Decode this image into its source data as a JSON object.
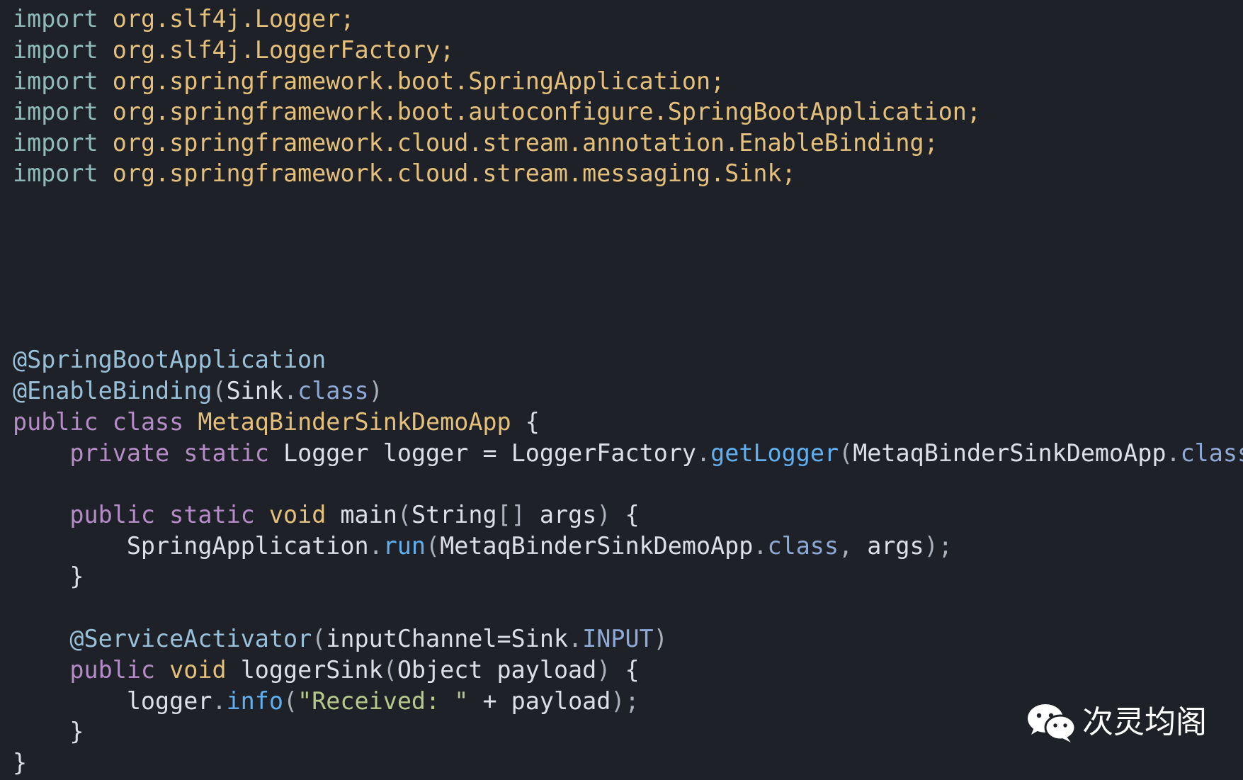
{
  "editor": {
    "theme_colors": {
      "background": "#1e2127",
      "import_keyword": "#8fbcbb",
      "package": "#e5c07b",
      "annotation": "#98c1d9",
      "keyword": "#b58cc8",
      "method": "#61afef",
      "string": "#b5c98a",
      "plain": "#dcdfe4"
    },
    "imports": [
      {
        "keyword": "import",
        "path": "org.slf4j.Logger;"
      },
      {
        "keyword": "import",
        "path": "org.slf4j.LoggerFactory;"
      },
      {
        "keyword": "import",
        "path": "org.springframework.boot.SpringApplication;"
      },
      {
        "keyword": "import",
        "path": "org.springframework.boot.autoconfigure.SpringBootApplication;"
      },
      {
        "keyword": "import",
        "path": "org.springframework.cloud.stream.annotation.EnableBinding;"
      },
      {
        "keyword": "import",
        "path": "org.springframework.cloud.stream.messaging.Sink;"
      }
    ],
    "code": {
      "annotation_1": "@SpringBootApplication",
      "annotation_2_name": "@EnableBinding",
      "annotation_2_open": "(",
      "annotation_2_arg": "Sink",
      "annotation_2_dot": ".",
      "annotation_2_class": "class",
      "annotation_2_close": ")",
      "class_public": "public",
      "class_kw": "class",
      "class_name": "MetaqBinderSinkDemoApp",
      "class_brace": "{",
      "field_private": "private",
      "field_static": "static",
      "field_type": "Logger",
      "field_name": "logger",
      "field_eq": "=",
      "field_factory": "LoggerFactory",
      "field_dot": ".",
      "field_method": "getLogger",
      "field_open": "(",
      "field_arg": "MetaqBinderSinkDemoApp",
      "field_dot2": ".",
      "field_class": "class",
      "field_close": ");",
      "main_public": "public",
      "main_static": "static",
      "main_void": "void",
      "main_name": "main",
      "main_open": "(",
      "main_argtype": "String",
      "main_brackets": "[]",
      "main_argname": "args",
      "main_close": ")",
      "main_brace": "{",
      "run_obj": "SpringApplication",
      "run_dot": ".",
      "run_method": "run",
      "run_open": "(",
      "run_arg": "MetaqBinderSinkDemoApp",
      "run_dot2": ".",
      "run_class": "class",
      "run_comma": ",",
      "run_args": "args",
      "run_close": ");",
      "main_end": "}",
      "sa_name": "@ServiceActivator",
      "sa_open": "(",
      "sa_arg": "inputChannel=Sink",
      "sa_dot": ".",
      "sa_const": "INPUT",
      "sa_close": ")",
      "sink_public": "public",
      "sink_void": "void",
      "sink_name": "loggerSink",
      "sink_open": "(",
      "sink_params": "Object payload",
      "sink_close": ")",
      "sink_brace": "{",
      "info_obj": "logger",
      "info_dot": ".",
      "info_method": "info",
      "info_open": "(",
      "info_str": "\"Received: \"",
      "info_plus": "+",
      "info_arg": "payload",
      "info_close": ");",
      "sink_end": "}",
      "class_end": "}"
    }
  },
  "watermark": {
    "icon": "wechat-icon",
    "text": "次灵均阁"
  }
}
